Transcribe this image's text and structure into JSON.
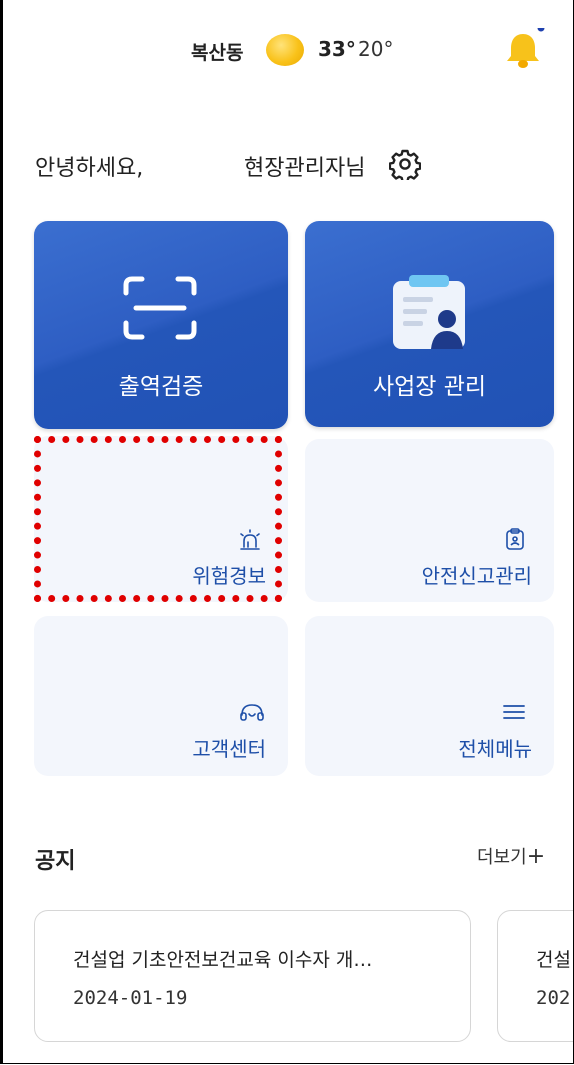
{
  "status": {
    "location": "복산동",
    "temp_high": "33°",
    "temp_low": "20°",
    "weather_icon": "sun-icon",
    "notification_dot_color": "#1e40af"
  },
  "greeting": {
    "hello": "안녕하세요,",
    "role": "현장관리자님"
  },
  "menu": {
    "checkin_verify": "출역검증",
    "site_manage": "사업장 관리",
    "danger_alert": "위험경보",
    "safety_report": "안전신고관리",
    "customer_center": "고객센터",
    "all_menu": "전체메뉴"
  },
  "notice": {
    "title": "공지",
    "more": "더보기",
    "items": [
      {
        "title": "건설업 기초안전보건교육 이수자 개…",
        "date": "2024-01-19"
      },
      {
        "title": "건설",
        "date": "202"
      }
    ]
  },
  "colors": {
    "primary": "#2456b9",
    "tile_light": "#f3f6fc",
    "highlight": "#e00000",
    "accent_text": "#1e4fa8"
  }
}
